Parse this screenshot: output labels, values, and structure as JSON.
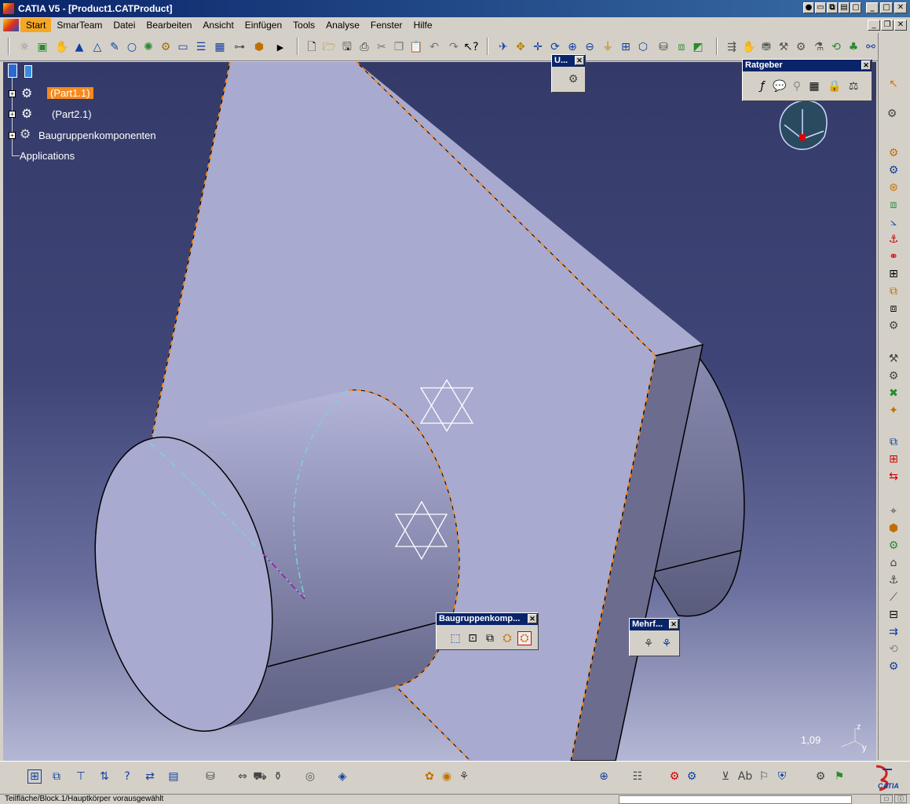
{
  "window": {
    "title": "CATIA V5 - [Product1.CATProduct]"
  },
  "menu": {
    "items": [
      {
        "label": "Start",
        "active": true
      },
      {
        "label": "SmarTeam"
      },
      {
        "label": "Datei"
      },
      {
        "label": "Bearbeiten"
      },
      {
        "label": "Ansicht"
      },
      {
        "label": "Einfügen"
      },
      {
        "label": "Tools"
      },
      {
        "label": "Analyse"
      },
      {
        "label": "Fenster"
      },
      {
        "label": "Hilfe"
      }
    ]
  },
  "tree": {
    "nodes": [
      {
        "label": "(Part1.1)",
        "selected": true
      },
      {
        "label": "(Part2.1)"
      },
      {
        "label": "Baugruppenkomponenten"
      },
      {
        "label": "Applications"
      }
    ]
  },
  "floating_toolbars": {
    "u": {
      "title": "U..."
    },
    "ratgeber": {
      "title": "Ratgeber"
    },
    "baugruppen": {
      "title": "Baugruppenkomp..."
    },
    "mehrf": {
      "title": "Mehrf..."
    }
  },
  "viewport": {
    "zoom_value": "1,09",
    "axis_z": "z",
    "axis_y": "y",
    "axis_x": "x",
    "colors": {
      "background_top": "#343a68",
      "part_face": "#a9aad0",
      "highlight_edge": "#f58a1f"
    }
  },
  "status": {
    "text": "Teilfläche/Block.1/Hauptkörper vorausgewählt"
  },
  "brand": {
    "logo_text": "CATIA"
  },
  "icons": {
    "toolbar_top": [
      "sun-icon",
      "image-icon",
      "hand-icon",
      "tetra-icon",
      "tetra-outline-icon",
      "pen-icon",
      "circle-icon",
      "wheel-icon",
      "gear-icon",
      "rect-icon",
      "list-icon",
      "table-icon",
      "tree-icon",
      "cube-group-icon",
      "arrow-right-icon",
      "new-icon",
      "open-icon",
      "save-icon",
      "print-icon",
      "cut-icon",
      "copy-icon",
      "paste-icon",
      "undo-icon",
      "redo-icon",
      "whatsthis-icon",
      "fly-icon",
      "fit-all-icon",
      "pan-icon",
      "rotate-icon",
      "zoom-in-icon",
      "zoom-out-icon",
      "normal-view-icon",
      "multi-view-icon",
      "iso-view-icon",
      "hide-show-icon",
      "swap-visible-icon",
      "render-icon"
    ]
  }
}
